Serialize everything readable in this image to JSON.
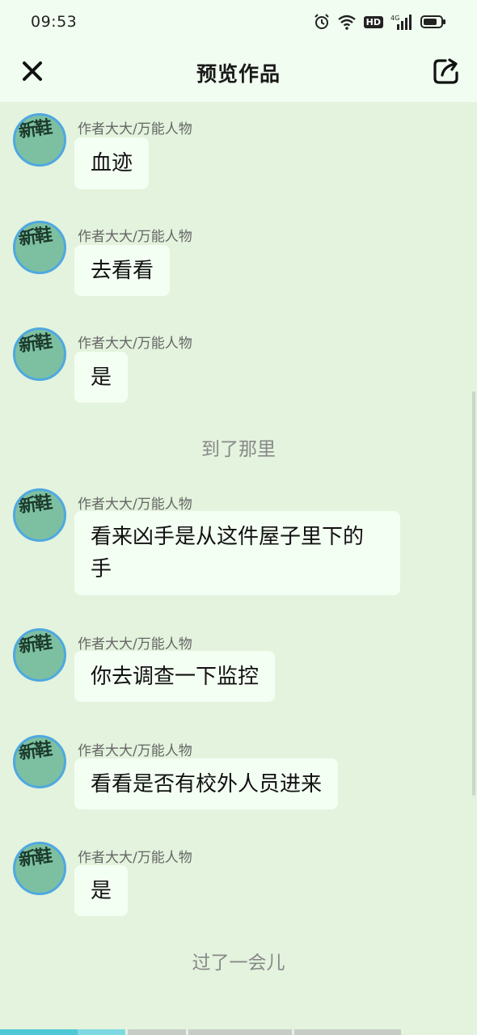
{
  "status": {
    "time": "09:53",
    "hd": "HD",
    "network": "4G"
  },
  "header": {
    "title": "预览作品",
    "close_icon": "close-icon",
    "share_icon": "share-icon"
  },
  "avatar_text": "新鞋",
  "messages": [
    {
      "sender": "作者大大/万能人物",
      "lines": [
        "血迹"
      ]
    },
    {
      "sender": "作者大大/万能人物",
      "lines": [
        "去看看"
      ]
    },
    {
      "sender": "作者大大/万能人物",
      "lines": [
        "是"
      ]
    },
    {
      "narration": "到了那里"
    },
    {
      "sender": "作者大大/万能人物",
      "lines": [
        "看来凶手是从这件屋子里下的",
        "手"
      ]
    },
    {
      "sender": "作者大大/万能人物",
      "lines": [
        "你去调查一下监控"
      ]
    },
    {
      "sender": "作者大大/万能人物",
      "lines": [
        "看看是否有校外人员进来"
      ]
    },
    {
      "sender": "作者大大/万能人物",
      "lines": [
        "是"
      ]
    },
    {
      "narration": "过了一会儿"
    }
  ],
  "colors": {
    "background": "#e3f3dd",
    "bubble": "#f4fff3",
    "avatar_border": "#4fa8e0",
    "progress_active": "#4ec8d6"
  }
}
